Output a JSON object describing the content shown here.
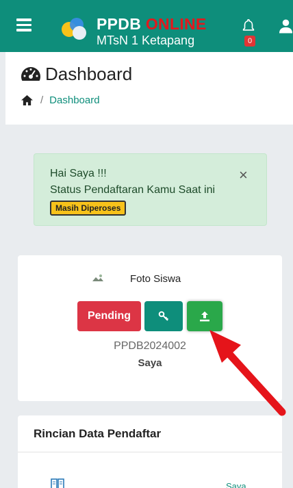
{
  "header": {
    "brand_main": "PPDB",
    "brand_accent": "ONLINE",
    "subtitle": "MTsN 1 Ketapang",
    "notification_count": "0",
    "icons": [
      "menu-icon",
      "bell-icon",
      "user-icon"
    ],
    "colors": {
      "bar": "#0e8e7b",
      "accent": "#e3181c"
    }
  },
  "page": {
    "title": "Dashboard",
    "breadcrumb": {
      "current": "Dashboard",
      "separator": "/"
    }
  },
  "alert": {
    "greeting": "Hai Saya !!!",
    "status_label": "Status Pendaftaran Kamu Saat ini",
    "status_badge": "Masih Diperoses",
    "close": "×"
  },
  "student_card": {
    "photo_label": "Foto Siswa",
    "pending_button": "Pending",
    "registration_number": "PPDB2024002",
    "name": "Saya",
    "action_icons": [
      "key-icon",
      "upload-icon"
    ]
  },
  "details_card": {
    "title": "Rincian Data Pendaftar",
    "row_value": "Saya"
  }
}
